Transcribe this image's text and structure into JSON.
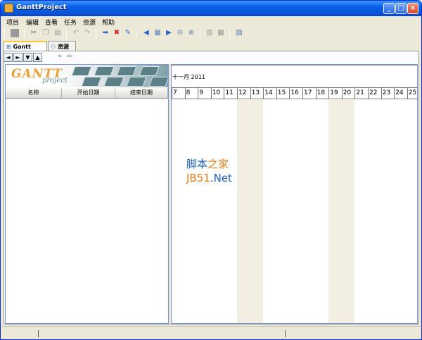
{
  "window": {
    "title": "GanttProject"
  },
  "menu": {
    "items": [
      "项目",
      "编辑",
      "查看",
      "任务",
      "资源",
      "帮助"
    ]
  },
  "tabs": [
    {
      "label": "Gantt"
    },
    {
      "label": "资源"
    }
  ],
  "logo": {
    "main": "GANTT",
    "sub": "project"
  },
  "task_table": {
    "columns": [
      "名称",
      "开始日期",
      "结束日期"
    ]
  },
  "chart": {
    "month": "十一月 2011",
    "days": [
      "7",
      "8",
      "9",
      "10",
      "11",
      "12",
      "13",
      "14",
      "15",
      "16",
      "17",
      "18",
      "19",
      "20",
      "21",
      "22",
      "23",
      "24",
      "25"
    ]
  },
  "watermark": {
    "line1_a": "脚本",
    "line1_b": "之家",
    "line2_a": "JB51",
    "line2_b": ".Net"
  },
  "colors": {
    "titlebar": "#0a5fe8",
    "weekend": "#f2efe2",
    "logo_accent": "#e8a13a"
  }
}
